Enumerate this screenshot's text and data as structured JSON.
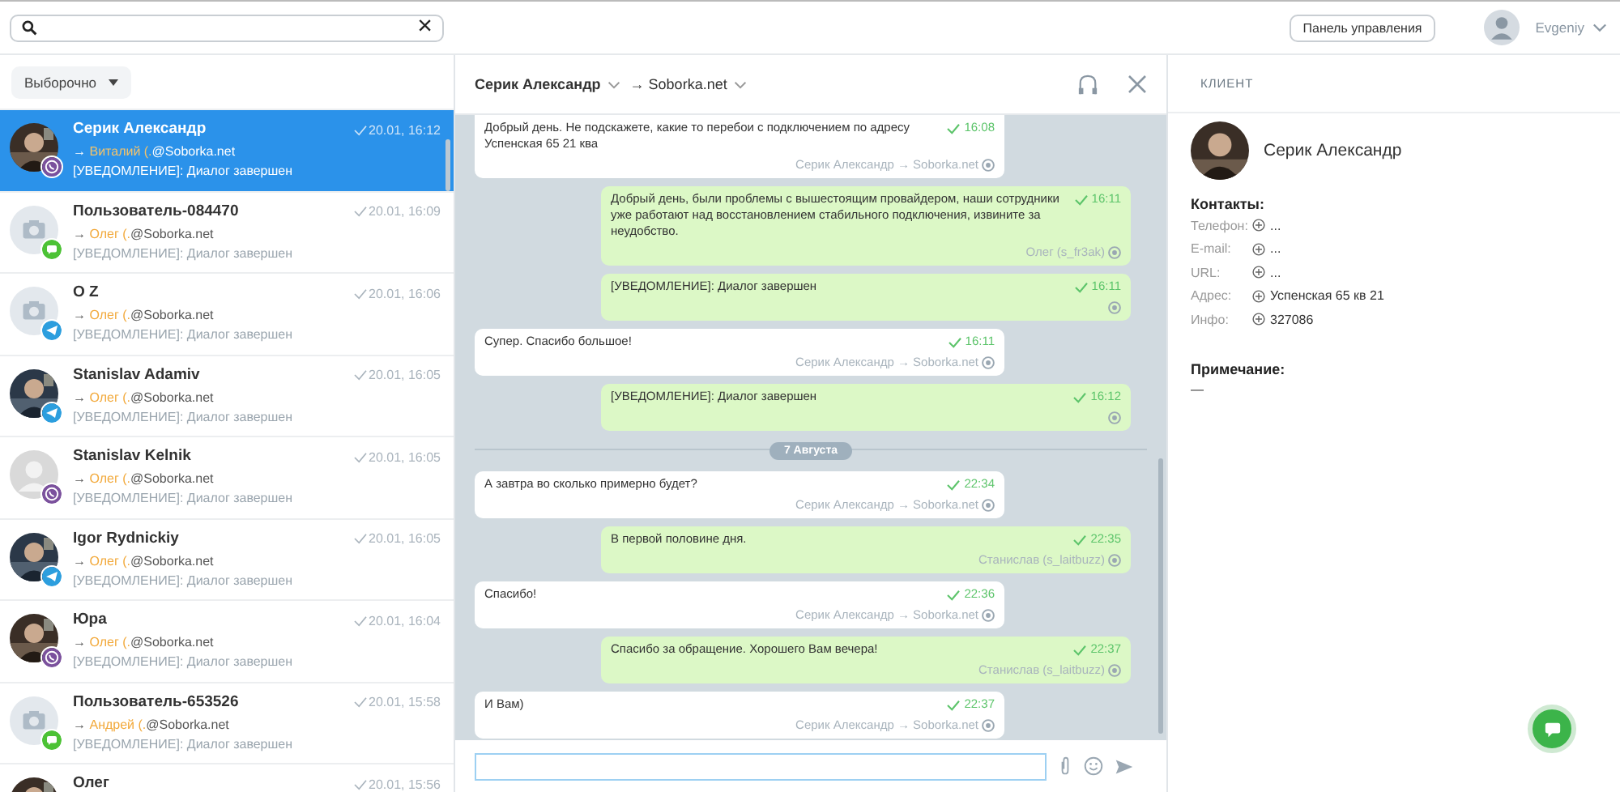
{
  "top_bar": {
    "search": {
      "clear": "×"
    },
    "panel_button": "Панель управления",
    "user": "Evgeniy"
  },
  "filter": {
    "label": "Выборочно"
  },
  "dialogs": [
    {
      "name": "Серик Александр",
      "arrow": "→",
      "agent": "Виталий (.",
      "domain": "@Soborka.net",
      "last": "[УВЕДОМЛЕНИЕ]: Диалог завершен",
      "time": "20.01, 16:12",
      "channel": {
        "kind": "viber"
      },
      "selected": true
    },
    {
      "name": "Пользователь-084470",
      "arrow": "→",
      "agent": "Олег (.",
      "domain": "@Soborka.net",
      "last": "[УВЕДОМЛЕНИЕ]: Диалог завершен",
      "time": "20.01, 16:09",
      "avatar": {
        "kind": "camera"
      },
      "channel": {
        "kind": "chat"
      },
      "selected": false
    },
    {
      "name": "O Z",
      "arrow": "→",
      "agent": "Олег (.",
      "domain": "@Soborka.net",
      "last": "[УВЕДОМЛЕНИЕ]: Диалог завершен",
      "time": "20.01, 16:06",
      "avatar": {
        "kind": "camera"
      },
      "channel": {
        "kind": "telegram"
      },
      "selected": false
    },
    {
      "name": "Stanislav Adamiv",
      "arrow": "→",
      "agent": "Олег (.",
      "domain": "@Soborka.net",
      "last": "[УВЕДОМЛЕНИЕ]: Диалог завершен",
      "time": "20.01, 16:05",
      "channel": {
        "kind": "telegram"
      },
      "selected": false
    },
    {
      "name": "Stanislav Kelnik",
      "arrow": "→",
      "agent": "Олег (.",
      "domain": "@Soborka.net",
      "last": "[УВЕДОМЛЕНИЕ]: Диалог завершен",
      "time": "20.01, 16:05",
      "avatar": {
        "kind": "silhouette"
      },
      "channel": {
        "kind": "viber"
      },
      "selected": false
    },
    {
      "name": "Igor Rydnickiy",
      "arrow": "→",
      "agent": "Олег (.",
      "domain": "@Soborka.net",
      "last": "[УВЕДОМЛЕНИЕ]: Диалог завершен",
      "time": "20.01, 16:05",
      "channel": {
        "kind": "telegram"
      },
      "selected": false
    },
    {
      "name": "Юра",
      "arrow": "→",
      "agent": "Олег (.",
      "domain": "@Soborka.net",
      "last": "[УВЕДОМЛЕНИЕ]: Диалог завершен",
      "time": "20.01, 16:04",
      "channel": {
        "kind": "viber"
      },
      "selected": false
    },
    {
      "name": "Пользователь-653526",
      "arrow": "→",
      "agent": "Андрей (.",
      "domain": "@Soborka.net",
      "last": "[УВЕДОМЛЕНИЕ]: Диалог завершен",
      "time": "20.01, 15:58",
      "avatar": {
        "kind": "camera"
      },
      "channel": {
        "kind": "chat"
      },
      "selected": false
    },
    {
      "name": "Олег",
      "time": "20.01, 15:56",
      "selected": false
    }
  ],
  "chat": {
    "contact": "Серик Александр",
    "target": "→ Soborka.net",
    "messages": [
      {
        "kind": "incoming",
        "text": "Добрый день. Не подскажете, какие то перебои с подключением по адресу Успенская 65 21 ква",
        "time": "16:08",
        "via": "Серик Александр → Soborka.net"
      },
      {
        "kind": "outgoing",
        "text": "Добрый день, были проблемы с вышестоящим провайдером, наши сотрудники уже работают над восстановлением стабильного подключения, извините за неудобство.",
        "time": "16:11",
        "via": "Олег (s_fr3ak)"
      },
      {
        "kind": "outgoing",
        "text": "[УВЕДОМЛЕНИЕ]: Диалог завершен",
        "time": "16:11"
      },
      {
        "kind": "incoming",
        "text": "Супер. Спасибо большое!",
        "time": "16:11",
        "via": "Серик Александр → Soborka.net"
      },
      {
        "kind": "outgoing",
        "text": "[УВЕДОМЛЕНИЕ]: Диалог завершен",
        "time": "16:12"
      },
      {
        "kind": "date",
        "text": "7 Августа"
      },
      {
        "kind": "incoming",
        "text": "А завтра во сколько примерно будет?",
        "time": "22:34",
        "via": "Серик Александр → Soborka.net"
      },
      {
        "kind": "outgoing",
        "text": "В первой половине дня.",
        "time": "22:35",
        "via": "Станислав (s_laitbuzz)"
      },
      {
        "kind": "incoming",
        "text": "Спасибо!",
        "time": "22:36",
        "via": "Серик Александр → Soborka.net"
      },
      {
        "kind": "outgoing",
        "text": "Спасибо за обращение. Хорошего Вам вечера!",
        "time": "22:37",
        "via": "Станислав (s_laitbuzz)"
      },
      {
        "kind": "incoming",
        "text": "И Вам)",
        "time": "22:37",
        "via": "Серик Александр → Soborka.net"
      }
    ]
  },
  "client": {
    "heading": "КЛИЕНТ",
    "name": "Серик Александр",
    "contacts_title": "Контакты:",
    "contacts": [
      {
        "label": "Телефон:",
        "value": "..."
      },
      {
        "label": "E-mail:",
        "value": "..."
      },
      {
        "label": "URL:",
        "value": "..."
      },
      {
        "label": "Адрес:",
        "value": "Успенская 65 кв 21"
      },
      {
        "label": "Инфо:",
        "value": "327086"
      }
    ],
    "note_title": "Примечание:",
    "note": "—"
  }
}
